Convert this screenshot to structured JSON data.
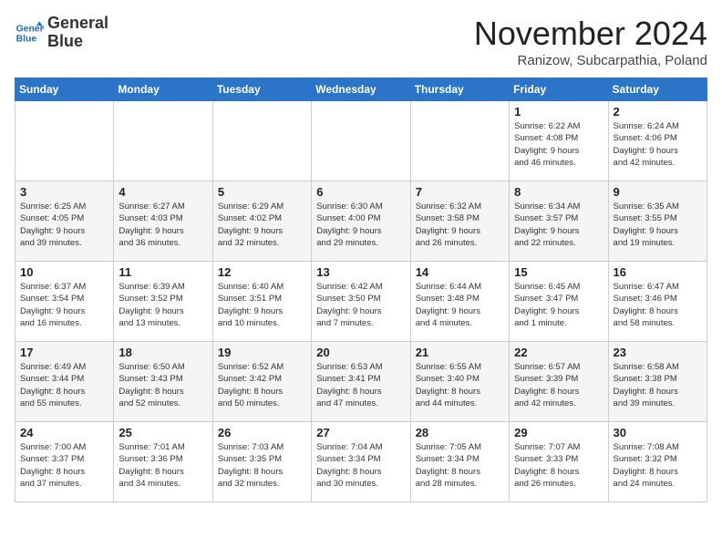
{
  "logo": {
    "line1": "General",
    "line2": "Blue"
  },
  "title": "November 2024",
  "location": "Ranizow, Subcarpathia, Poland",
  "weekdays": [
    "Sunday",
    "Monday",
    "Tuesday",
    "Wednesday",
    "Thursday",
    "Friday",
    "Saturday"
  ],
  "weeks": [
    [
      {
        "day": "",
        "info": ""
      },
      {
        "day": "",
        "info": ""
      },
      {
        "day": "",
        "info": ""
      },
      {
        "day": "",
        "info": ""
      },
      {
        "day": "",
        "info": ""
      },
      {
        "day": "1",
        "info": "Sunrise: 6:22 AM\nSunset: 4:08 PM\nDaylight: 9 hours\nand 46 minutes."
      },
      {
        "day": "2",
        "info": "Sunrise: 6:24 AM\nSunset: 4:06 PM\nDaylight: 9 hours\nand 42 minutes."
      }
    ],
    [
      {
        "day": "3",
        "info": "Sunrise: 6:25 AM\nSunset: 4:05 PM\nDaylight: 9 hours\nand 39 minutes."
      },
      {
        "day": "4",
        "info": "Sunrise: 6:27 AM\nSunset: 4:03 PM\nDaylight: 9 hours\nand 36 minutes."
      },
      {
        "day": "5",
        "info": "Sunrise: 6:29 AM\nSunset: 4:02 PM\nDaylight: 9 hours\nand 32 minutes."
      },
      {
        "day": "6",
        "info": "Sunrise: 6:30 AM\nSunset: 4:00 PM\nDaylight: 9 hours\nand 29 minutes."
      },
      {
        "day": "7",
        "info": "Sunrise: 6:32 AM\nSunset: 3:58 PM\nDaylight: 9 hours\nand 26 minutes."
      },
      {
        "day": "8",
        "info": "Sunrise: 6:34 AM\nSunset: 3:57 PM\nDaylight: 9 hours\nand 22 minutes."
      },
      {
        "day": "9",
        "info": "Sunrise: 6:35 AM\nSunset: 3:55 PM\nDaylight: 9 hours\nand 19 minutes."
      }
    ],
    [
      {
        "day": "10",
        "info": "Sunrise: 6:37 AM\nSunset: 3:54 PM\nDaylight: 9 hours\nand 16 minutes."
      },
      {
        "day": "11",
        "info": "Sunrise: 6:39 AM\nSunset: 3:52 PM\nDaylight: 9 hours\nand 13 minutes."
      },
      {
        "day": "12",
        "info": "Sunrise: 6:40 AM\nSunset: 3:51 PM\nDaylight: 9 hours\nand 10 minutes."
      },
      {
        "day": "13",
        "info": "Sunrise: 6:42 AM\nSunset: 3:50 PM\nDaylight: 9 hours\nand 7 minutes."
      },
      {
        "day": "14",
        "info": "Sunrise: 6:44 AM\nSunset: 3:48 PM\nDaylight: 9 hours\nand 4 minutes."
      },
      {
        "day": "15",
        "info": "Sunrise: 6:45 AM\nSunset: 3:47 PM\nDaylight: 9 hours\nand 1 minute."
      },
      {
        "day": "16",
        "info": "Sunrise: 6:47 AM\nSunset: 3:46 PM\nDaylight: 8 hours\nand 58 minutes."
      }
    ],
    [
      {
        "day": "17",
        "info": "Sunrise: 6:49 AM\nSunset: 3:44 PM\nDaylight: 8 hours\nand 55 minutes."
      },
      {
        "day": "18",
        "info": "Sunrise: 6:50 AM\nSunset: 3:43 PM\nDaylight: 8 hours\nand 52 minutes."
      },
      {
        "day": "19",
        "info": "Sunrise: 6:52 AM\nSunset: 3:42 PM\nDaylight: 8 hours\nand 50 minutes."
      },
      {
        "day": "20",
        "info": "Sunrise: 6:53 AM\nSunset: 3:41 PM\nDaylight: 8 hours\nand 47 minutes."
      },
      {
        "day": "21",
        "info": "Sunrise: 6:55 AM\nSunset: 3:40 PM\nDaylight: 8 hours\nand 44 minutes."
      },
      {
        "day": "22",
        "info": "Sunrise: 6:57 AM\nSunset: 3:39 PM\nDaylight: 8 hours\nand 42 minutes."
      },
      {
        "day": "23",
        "info": "Sunrise: 6:58 AM\nSunset: 3:38 PM\nDaylight: 8 hours\nand 39 minutes."
      }
    ],
    [
      {
        "day": "24",
        "info": "Sunrise: 7:00 AM\nSunset: 3:37 PM\nDaylight: 8 hours\nand 37 minutes."
      },
      {
        "day": "25",
        "info": "Sunrise: 7:01 AM\nSunset: 3:36 PM\nDaylight: 8 hours\nand 34 minutes."
      },
      {
        "day": "26",
        "info": "Sunrise: 7:03 AM\nSunset: 3:35 PM\nDaylight: 8 hours\nand 32 minutes."
      },
      {
        "day": "27",
        "info": "Sunrise: 7:04 AM\nSunset: 3:34 PM\nDaylight: 8 hours\nand 30 minutes."
      },
      {
        "day": "28",
        "info": "Sunrise: 7:05 AM\nSunset: 3:34 PM\nDaylight: 8 hours\nand 28 minutes."
      },
      {
        "day": "29",
        "info": "Sunrise: 7:07 AM\nSunset: 3:33 PM\nDaylight: 8 hours\nand 26 minutes."
      },
      {
        "day": "30",
        "info": "Sunrise: 7:08 AM\nSunset: 3:32 PM\nDaylight: 8 hours\nand 24 minutes."
      }
    ]
  ]
}
